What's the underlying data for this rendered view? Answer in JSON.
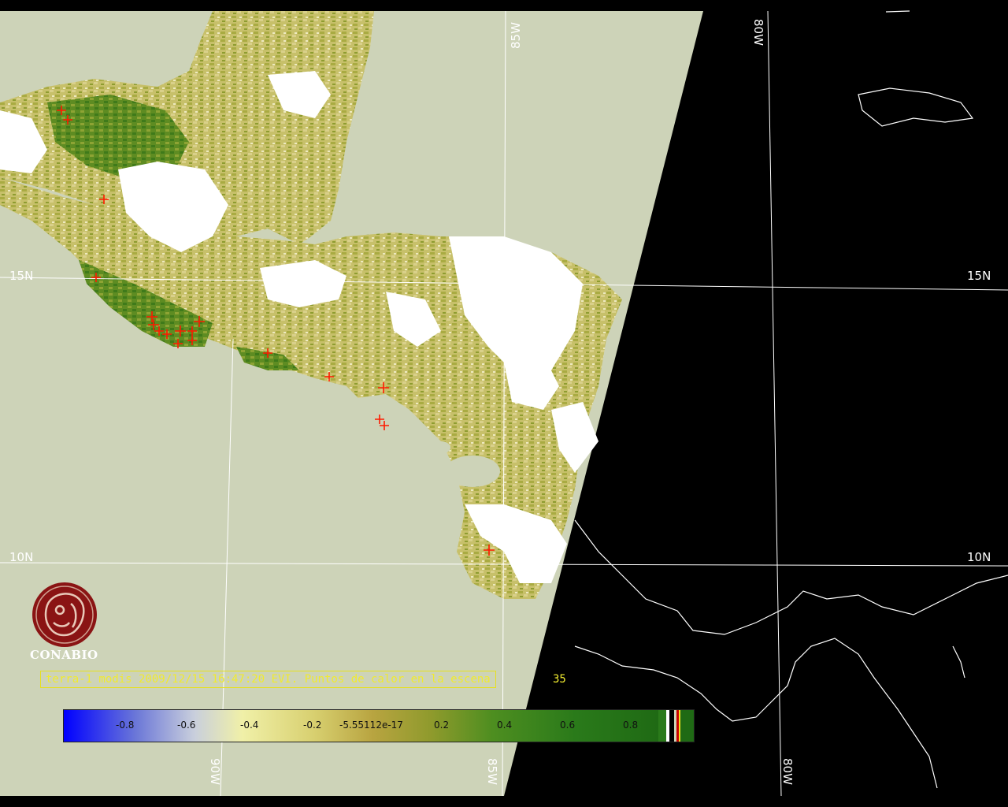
{
  "map": {
    "grid_labels": {
      "lon_85w_top": "85W",
      "lon_80w_top": "80W",
      "lat_15n_left": "15N",
      "lat_15n_right": "15N",
      "lat_10n_left": "10N",
      "lat_10n_right": "10N",
      "lon_90w_bottom": "90W",
      "lon_85w_bottom": "85W",
      "lon_80w_bottom": "80W"
    },
    "colors": {
      "swath_background": "#cdd3b8",
      "night_background": "#000000",
      "grid_line": "#ffffff",
      "coastline": "#ffffff",
      "fire_marker": "#ff1a00",
      "cloud": "#ffffff"
    }
  },
  "logo": {
    "name": "CONABIO"
  },
  "caption": {
    "text": "terra-1 modis 2009/12/15 16:47:20 EVI. Puntos de calor en la escena",
    "count": "35"
  },
  "colorbar": {
    "ticks": [
      "-0.8",
      "-0.6",
      "-0.4",
      "-0.2",
      "-5.55112e-17",
      "0.2",
      "0.4",
      "0.6",
      "0.8"
    ]
  }
}
